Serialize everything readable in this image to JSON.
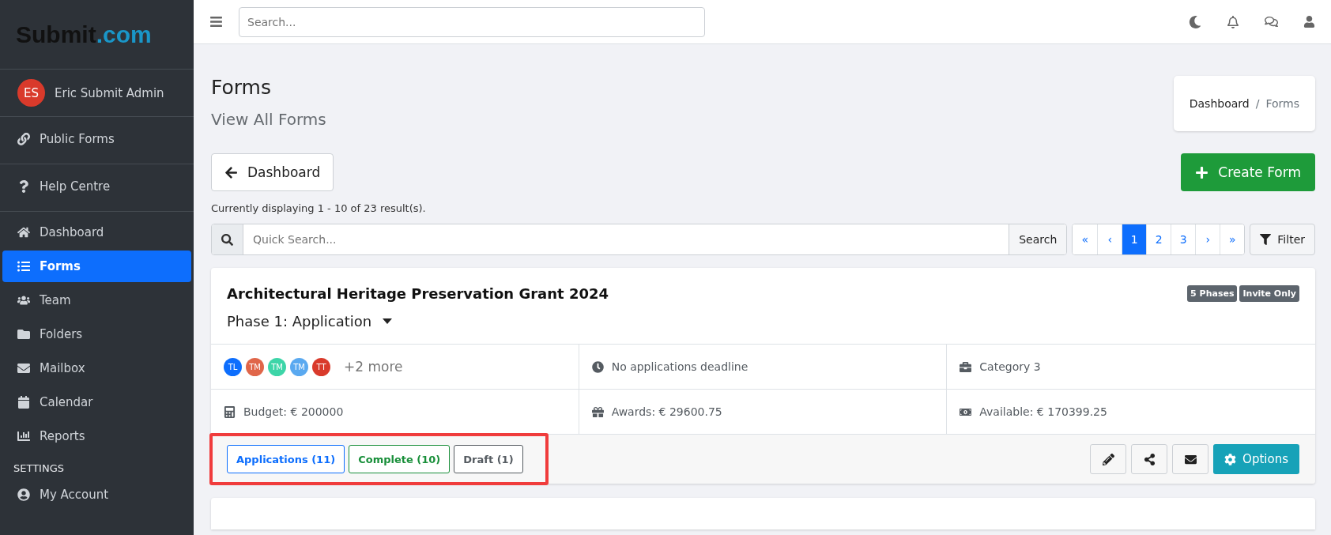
{
  "sidebar": {
    "logo": {
      "main": "Submit",
      "suffix": ".com"
    },
    "user": {
      "initials": "ES",
      "name": "Eric Submit Admin"
    },
    "top_links": [
      {
        "label": "Public Forms"
      },
      {
        "label": "Help Centre"
      }
    ],
    "items": [
      {
        "label": "Dashboard",
        "selected": false
      },
      {
        "label": "Forms",
        "selected": true
      },
      {
        "label": "Team",
        "selected": false
      },
      {
        "label": "Folders",
        "selected": false
      },
      {
        "label": "Mailbox",
        "selected": false
      },
      {
        "label": "Calendar",
        "selected": false
      },
      {
        "label": "Reports",
        "selected": false
      }
    ],
    "section_title": "SETTINGS",
    "settings_items": [
      {
        "label": "My Account",
        "selected": false
      }
    ]
  },
  "topbar": {
    "search": {
      "placeholder": "Search..."
    }
  },
  "page": {
    "title": "Forms",
    "subtitle": "View All Forms",
    "breadcrumb_separator": "/",
    "breadcrumb": [
      {
        "label": "Dashboard",
        "selected": false
      },
      {
        "label": "Forms",
        "selected": true
      }
    ],
    "back_button": "Dashboard",
    "create_button": "Create Form",
    "result_info": "Currently displaying 1 - 10 of 23 result(s).",
    "quick_search": {
      "placeholder": "Quick Search...",
      "button": "Search"
    },
    "pagination": [
      {
        "label": "«",
        "selected": false
      },
      {
        "label": "‹",
        "selected": false
      },
      {
        "label": "1",
        "selected": true
      },
      {
        "label": "2",
        "selected": false
      },
      {
        "label": "3",
        "selected": false
      },
      {
        "label": "›",
        "selected": false
      },
      {
        "label": "»",
        "selected": false
      }
    ],
    "filter_button": "Filter"
  },
  "form_card": {
    "title": "Architectural Heritage Preservation Grant 2024",
    "badges": [
      "5 Phases",
      "Invite Only"
    ],
    "phase": "Phase 1: Application",
    "members": [
      {
        "initials": "TL",
        "color": "#0d6efd"
      },
      {
        "initials": "TM",
        "color": "#e0664a"
      },
      {
        "initials": "TM",
        "color": "#3dd5a8"
      },
      {
        "initials": "TM",
        "color": "#5aa9f0"
      },
      {
        "initials": "TT",
        "color": "#d93a2b"
      }
    ],
    "more_members": "+2 more",
    "info": [
      "No applications deadline",
      "Category 3",
      "Budget: € 200000",
      "Awards: € 29600.75",
      "Available: € 170399.25"
    ],
    "status_buttons": [
      {
        "label": "Applications (11)",
        "color": "#0d6efd"
      },
      {
        "label": "Complete (10)",
        "color": "#198f3a"
      },
      {
        "label": "Draft (1)",
        "color": "#555b61"
      }
    ],
    "status_highlighted": true,
    "options_button": "Options"
  }
}
